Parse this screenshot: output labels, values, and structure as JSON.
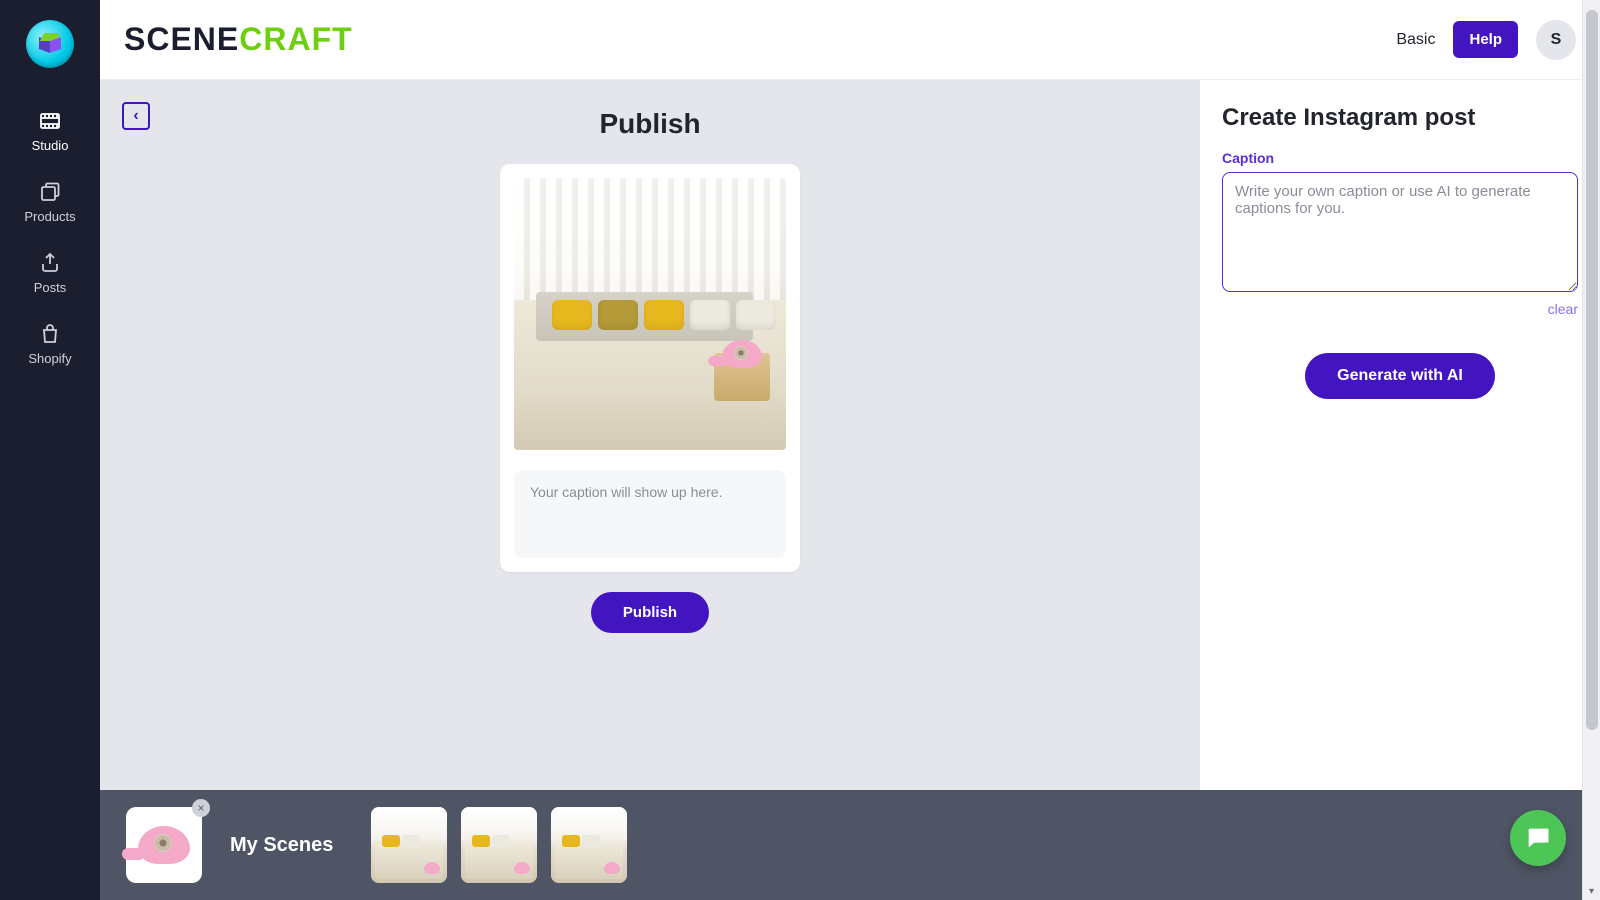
{
  "brand": {
    "part1": "SCENE",
    "part2": "CRAFT"
  },
  "topbar": {
    "plan_label": "Basic",
    "help_label": "Help",
    "avatar_initial": "S"
  },
  "leftnav": {
    "items": [
      {
        "key": "studio",
        "label": "Studio"
      },
      {
        "key": "products",
        "label": "Products"
      },
      {
        "key": "posts",
        "label": "Posts"
      },
      {
        "key": "shopify",
        "label": "Shopify"
      }
    ]
  },
  "canvas": {
    "title": "Publish",
    "caption_placeholder": "Your caption will show up here.",
    "publish_label": "Publish"
  },
  "side_panel": {
    "title": "Create Instagram post",
    "caption_field_label": "Caption",
    "caption_placeholder": "Write your own caption or use AI to generate captions for you.",
    "clear_label": "clear",
    "generate_label": "Generate with AI"
  },
  "tray": {
    "title": "My Scenes",
    "scene_count": 3
  }
}
